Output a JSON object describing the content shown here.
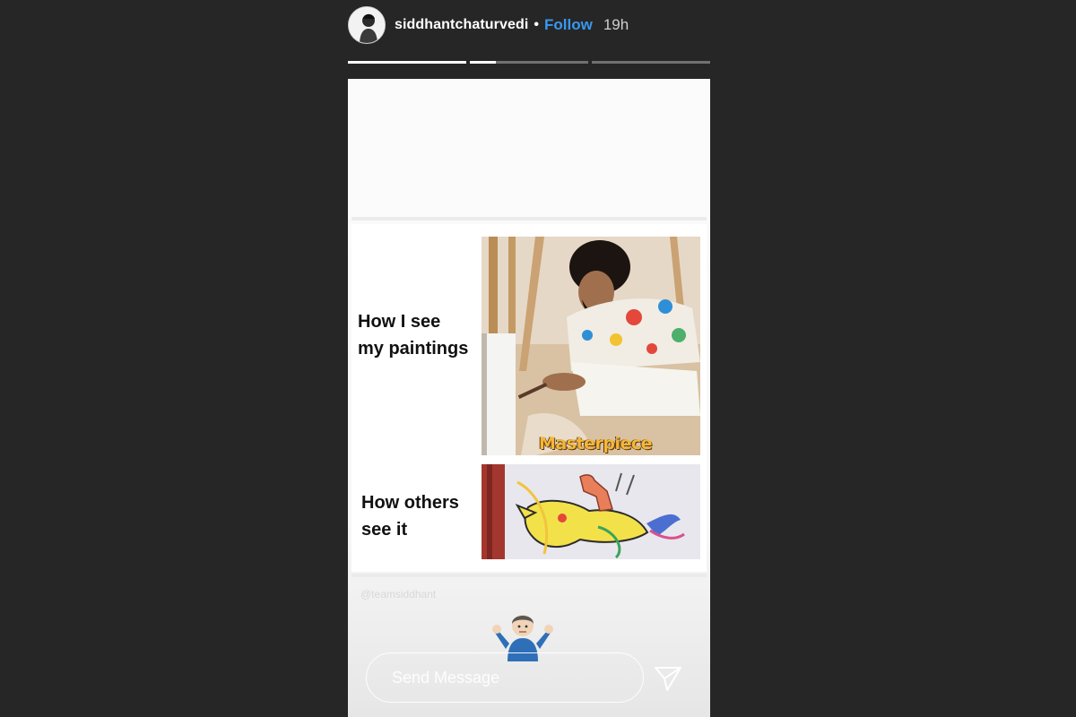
{
  "header": {
    "username": "siddhantchaturvedi",
    "separator": "•",
    "follow_label": "Follow",
    "time": "19h"
  },
  "progress": {
    "segments": [
      1.0,
      0.22,
      0.0
    ]
  },
  "story": {
    "caption_top": [
      "How I see",
      "my paintings"
    ],
    "caption_bottom": [
      "How others",
      "see it"
    ],
    "photo_label": "Masterpiece",
    "watermark": "@teamsiddhant"
  },
  "footer": {
    "message_placeholder": "Send Message"
  },
  "icons": {
    "avatar": "profile-avatar",
    "shrug": "shrug-emoji",
    "send": "paper-plane-icon"
  },
  "colors": {
    "background": "#262626",
    "follow": "#3897f0",
    "masterpiece_text": "#f5b63a"
  }
}
